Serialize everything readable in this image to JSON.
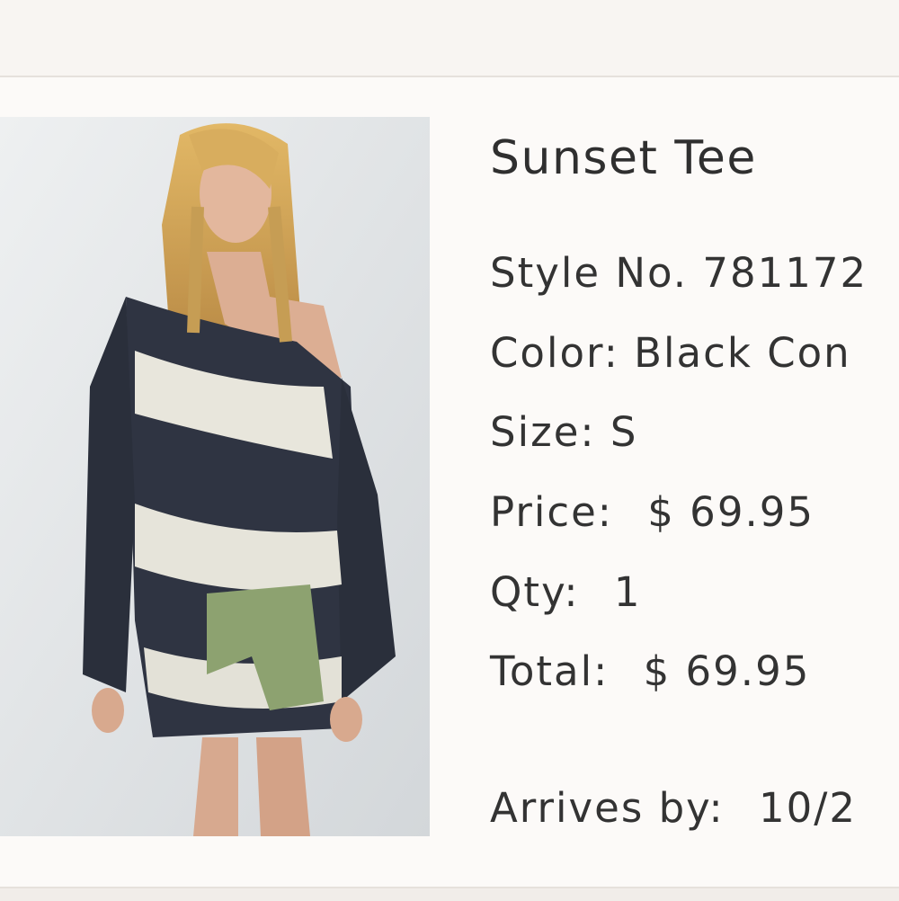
{
  "product": {
    "name": "Sunset Tee",
    "image_alt": "Model wearing black and white tie-dye ribbed oversized tee with green shorts",
    "style": {
      "label": "Style No.",
      "value": "781172"
    },
    "color": {
      "label": "Color:",
      "value": "Black Con"
    },
    "size": {
      "label": "Size:",
      "value": "S"
    },
    "price": {
      "label": "Price:",
      "value": "$ 69.95"
    },
    "qty": {
      "label": "Qty:",
      "value": "1"
    },
    "total": {
      "label": "Total:",
      "value": "$ 69.95"
    },
    "arrives": {
      "label": "Arrives by:",
      "value": "10/2"
    }
  },
  "colors": {
    "page_bg": "#f8f5f2",
    "card_bg": "#fcfaf8",
    "text": "#333333"
  }
}
